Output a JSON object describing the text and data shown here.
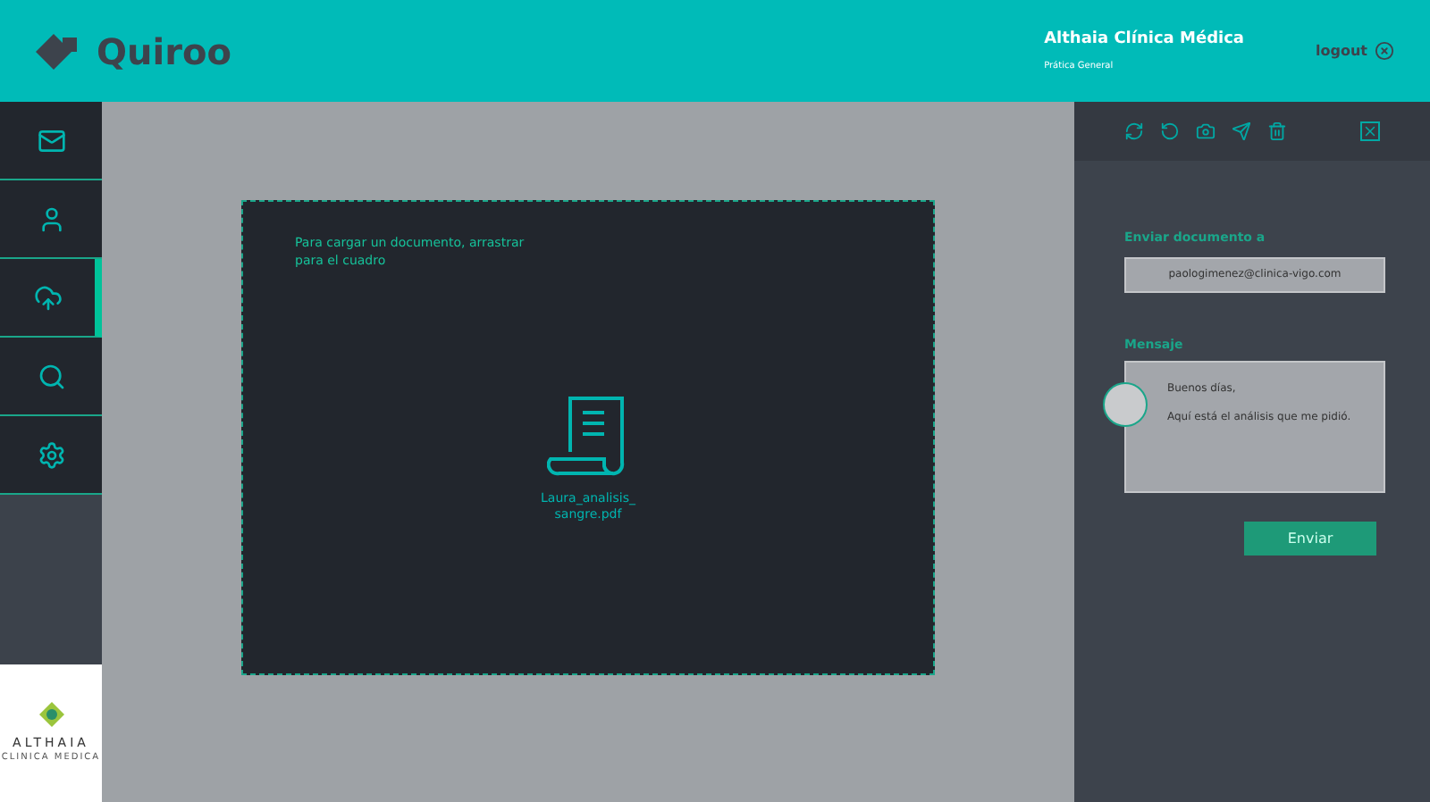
{
  "header": {
    "logo": "Quiroo",
    "clinic": "Althaia Clínica Médica",
    "department": "Prática General",
    "logout": "logout"
  },
  "sidebar": {
    "items": [
      {
        "kind": "mail",
        "selected": false
      },
      {
        "kind": "person",
        "selected": false
      },
      {
        "kind": "upload",
        "selected": true
      },
      {
        "kind": "search",
        "selected": false
      },
      {
        "kind": "settings",
        "selected": false
      }
    ],
    "brand": "ALTHAIA",
    "brand_sub": "CLINICA MEDICA"
  },
  "dropzone": {
    "hint": "Para cargar un documento, arrastrar para el cuadro",
    "file": "Laura_analisis_ sangre.pdf"
  },
  "panel": {
    "recipient_label": "Enviar documento a",
    "recipient": "paologimenez@clinica-vigo.com",
    "message_label": "Mensaje",
    "message_lines": [
      "Buenos días,",
      "Aquí está el análisis que me pidió."
    ],
    "send": "Enviar"
  }
}
